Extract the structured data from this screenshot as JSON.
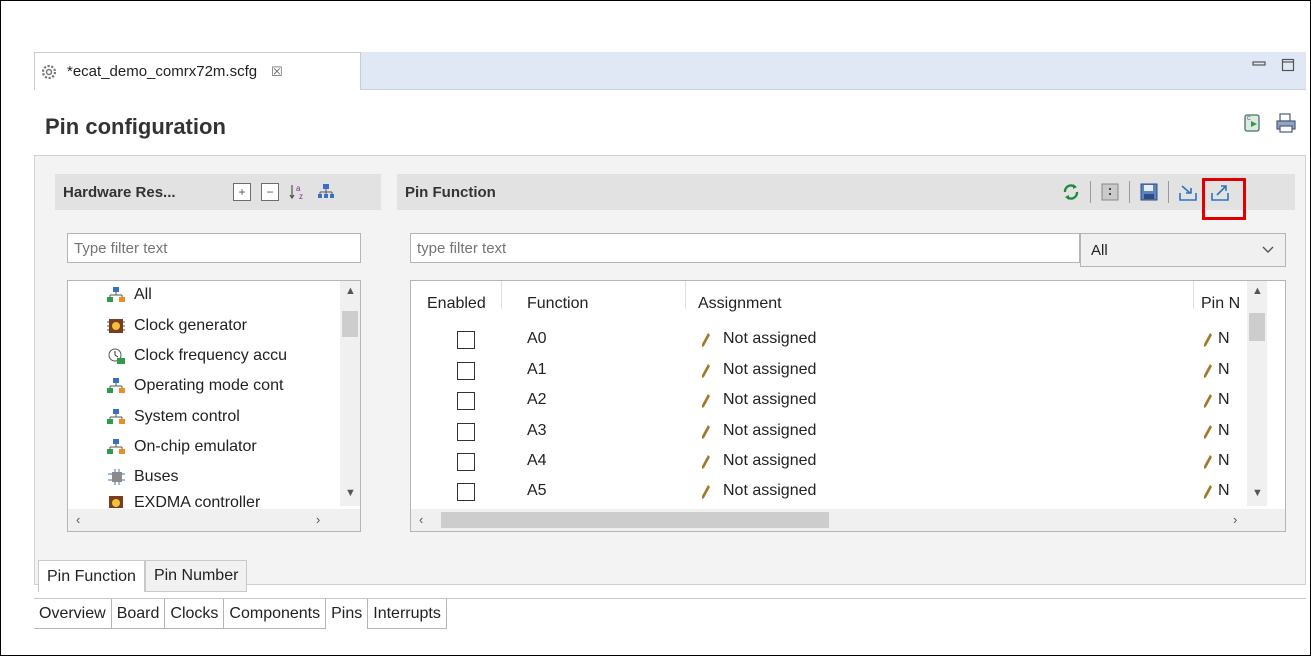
{
  "editor": {
    "tab_title": "*ecat_demo_comrx72m.scfg",
    "close_glyph": "☒",
    "minimize_glyph": "▭",
    "maximize_glyph": "□"
  },
  "page": {
    "title": "Pin configuration"
  },
  "hardware_resources": {
    "header": "Hardware Res...",
    "filter_placeholder": "Type filter text",
    "tree_items": [
      {
        "label": "All",
        "icon": "network-icon"
      },
      {
        "label": "Clock generator",
        "icon": "clock-chip-icon"
      },
      {
        "label": "Clock frequency accu",
        "icon": "clock-check-icon"
      },
      {
        "label": "Operating mode cont",
        "icon": "network-icon"
      },
      {
        "label": "System control",
        "icon": "network-icon"
      },
      {
        "label": "On-chip emulator",
        "icon": "network-icon"
      },
      {
        "label": "Buses",
        "icon": "bus-icon"
      },
      {
        "label": "EXDMA controller",
        "icon": "chip-icon"
      }
    ]
  },
  "pin_function": {
    "header": "Pin Function",
    "filter_placeholder": "type filter text",
    "select_value": "All",
    "columns": {
      "enabled": "Enabled",
      "function": "Function",
      "assignment": "Assignment",
      "pin_number": "Pin N"
    },
    "rows": [
      {
        "function": "A0",
        "assignment": "Not assigned",
        "pin": "N"
      },
      {
        "function": "A1",
        "assignment": "Not assigned",
        "pin": "N"
      },
      {
        "function": "A2",
        "assignment": "Not assigned",
        "pin": "N"
      },
      {
        "function": "A3",
        "assignment": "Not assigned",
        "pin": "N"
      },
      {
        "function": "A4",
        "assignment": "Not assigned",
        "pin": "N"
      },
      {
        "function": "A5",
        "assignment": "Not assigned",
        "pin": "N"
      }
    ]
  },
  "inner_tabs": [
    "Pin Function",
    "Pin Number"
  ],
  "editor_tabs": [
    "Overview",
    "Board",
    "Clocks",
    "Components",
    "Pins",
    "Interrupts"
  ],
  "colors": {
    "highlight": "#e00000",
    "tab_bar": "#dfe8f4"
  }
}
